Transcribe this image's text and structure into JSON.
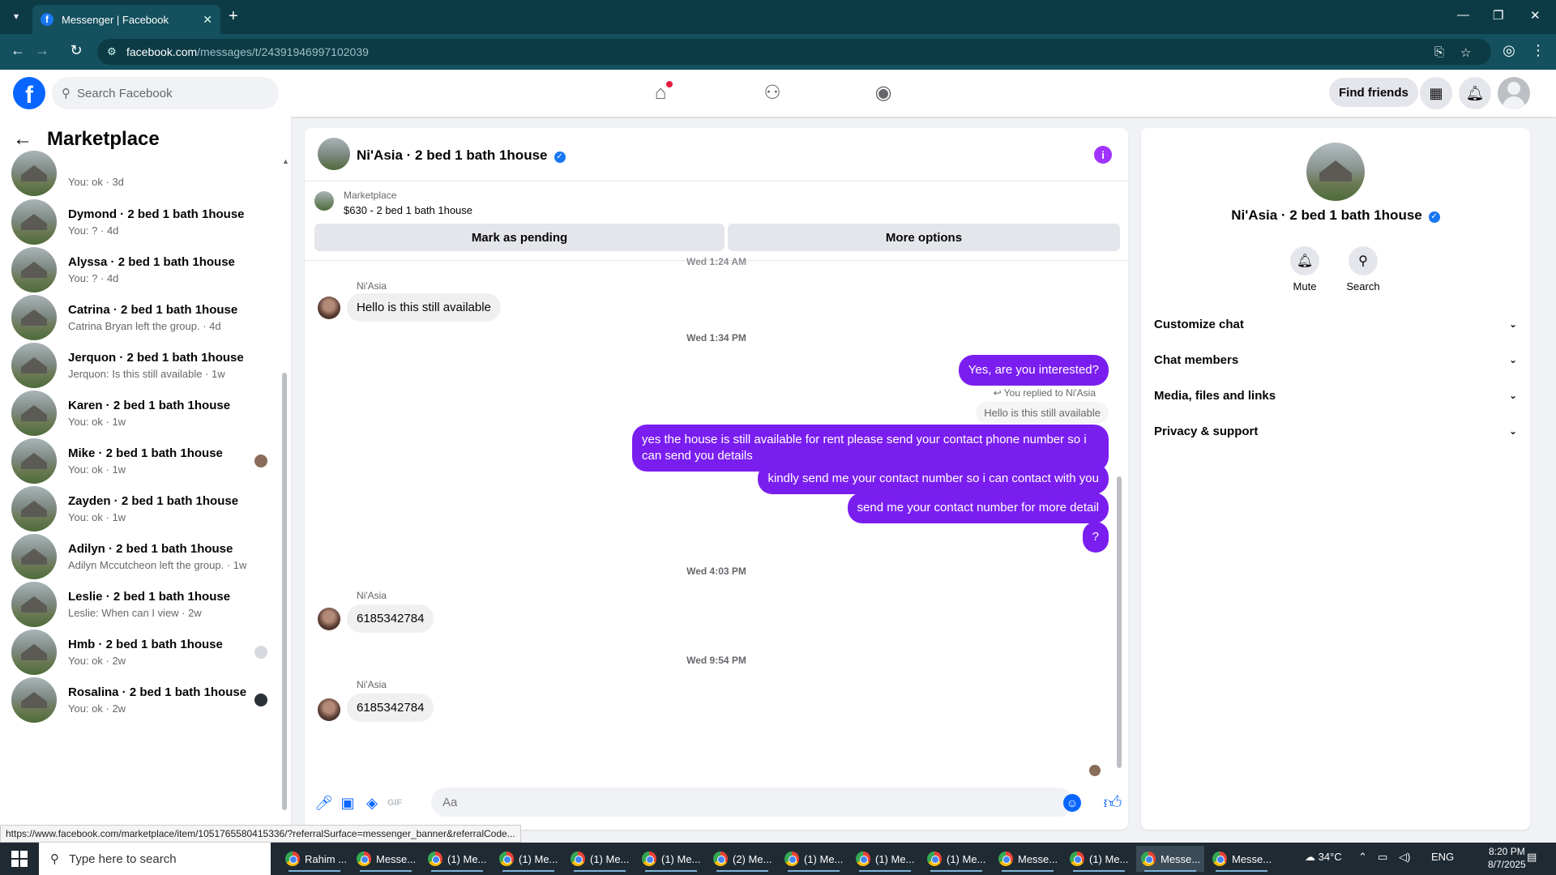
{
  "browser": {
    "tab_title": "Messenger | Facebook",
    "url_host": "facebook.com",
    "url_path": "/messages/t/24391946997102039"
  },
  "fb_header": {
    "search_placeholder": "Search Facebook",
    "find_friends": "Find friends"
  },
  "sidebar": {
    "title": "Marketplace",
    "conversations": [
      {
        "name": "",
        "sub": "You: ok · 3d"
      },
      {
        "name": "Dymond · 2 bed 1 bath 1house",
        "sub": "You: ? · 4d"
      },
      {
        "name": "Alyssa · 2 bed 1 bath 1house",
        "sub": "You: ? · 4d"
      },
      {
        "name": "Catrina · 2 bed 1 bath 1house",
        "sub": "Catrina Bryan left the group. · 4d"
      },
      {
        "name": "Jerquon · 2 bed 1 bath 1house",
        "sub": "Jerquon: Is this still available · 1w"
      },
      {
        "name": "Karen · 2 bed 1 bath 1house",
        "sub": "You: ok · 1w"
      },
      {
        "name": "Mike · 2 bed 1 bath 1house",
        "sub": "You: ok · 1w"
      },
      {
        "name": "Zayden · 2 bed 1 bath 1house",
        "sub": "You: ok · 1w"
      },
      {
        "name": "Adilyn · 2 bed 1 bath 1house",
        "sub": "Adilyn Mccutcheon left the group. · 1w"
      },
      {
        "name": "Leslie · 2 bed 1 bath 1house",
        "sub": "Leslie: When can I view · 2w"
      },
      {
        "name": "Hmb · 2 bed 1 bath 1house",
        "sub": "You: ok · 2w"
      },
      {
        "name": "Rosalina · 2 bed 1 bath 1house",
        "sub": "You: ok · 2w"
      }
    ]
  },
  "chat": {
    "title": "Ni'Asia · 2 bed 1 bath 1house",
    "marketplace_label": "Marketplace",
    "listing": "$630 - 2 bed 1 bath 1house",
    "mark_pending": "Mark as pending",
    "more_options": "More options",
    "ts_top": "Wed 1:24 AM",
    "sender": "Ni'Asia",
    "msg1": "Hello is this still available",
    "ts2": "Wed 1:34 PM",
    "out1": "Yes, are you interested?",
    "reply_note": "You replied to Ni'Asia",
    "reply_quote": "Hello is this still available",
    "out2": "yes the house is still available for rent please send your contact phone number so i can send you details",
    "out3": "kindly send me your contact number so i can contact with you",
    "out4": "send me your contact number for more detail",
    "out5": "?",
    "ts3": "Wed 4:03 PM",
    "msg2": "6185342784",
    "ts4": "Wed 9:54 PM",
    "msg3": "6185342784",
    "composer_placeholder": "Aa"
  },
  "info_panel": {
    "name": "Ni'Asia · 2 bed 1 bath 1house",
    "mute": "Mute",
    "search": "Search",
    "rows": [
      "Customize chat",
      "Chat members",
      "Media, files and links",
      "Privacy & support"
    ]
  },
  "status_url": "https://www.facebook.com/marketplace/item/1051765580415336/?referralSurface=messenger_banner&referralCode...",
  "taskbar": {
    "search_placeholder": "Type here to search",
    "apps": [
      "Rahim ...",
      "Messe...",
      "(1) Me...",
      "(1) Me...",
      "(1) Me...",
      "(1) Me...",
      "(2) Me...",
      "(1) Me...",
      "(1) Me...",
      "(1) Me...",
      "Messe...",
      "(1) Me...",
      "Messe...",
      "Messe..."
    ],
    "weather": "34°C",
    "lang": "ENG",
    "time": "8:20 PM",
    "date": "8/7/2025"
  }
}
